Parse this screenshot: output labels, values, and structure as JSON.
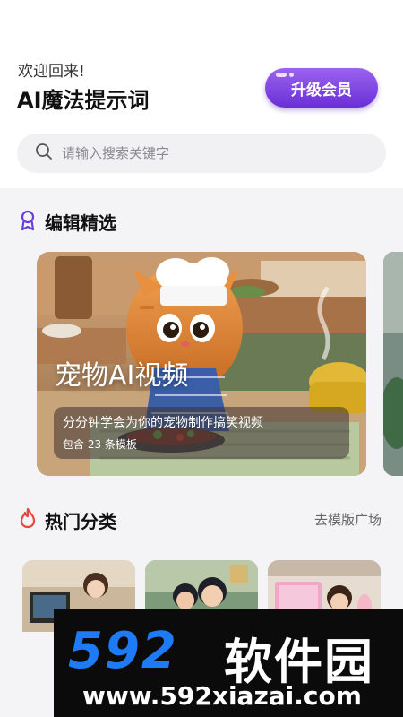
{
  "header": {
    "welcome": "欢迎回来!",
    "title": "AI魔法提示词",
    "upgrade_label": "升级会员"
  },
  "search": {
    "placeholder": "请输入搜索关键字",
    "icon": "search-icon"
  },
  "editor_picks": {
    "title": "编辑精选",
    "icon": "award-ribbon-icon",
    "accent": "#6a3fd9",
    "card": {
      "title": "宠物AI视频",
      "description": "分分钟学会为你的宠物制作搞笑视频",
      "count_text": "包含 23 条模板"
    }
  },
  "hot_categories": {
    "title": "热门分类",
    "icon": "flame-icon",
    "accent": "#e6463c",
    "more_label": "去模版广场"
  },
  "watermark": {
    "logo": "592",
    "brand": "软件园",
    "url": "www.592xiazai.com"
  },
  "colors": {
    "primary": "#7a45e0",
    "background": "#f4f4f6",
    "search_bg": "#f1f1f4"
  }
}
